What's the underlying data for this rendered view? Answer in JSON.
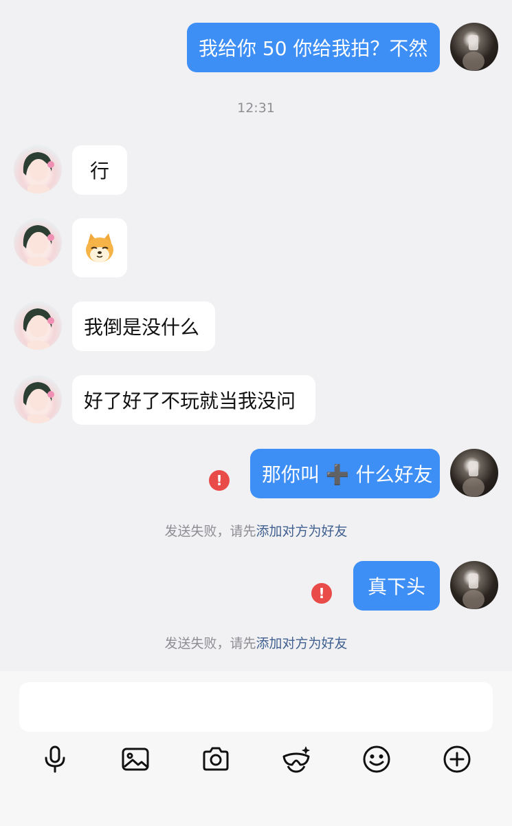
{
  "messages": [
    {
      "side": "out",
      "text": "我给你 50 你给我拍？不然"
    },
    {
      "side": "in",
      "text": "行"
    },
    {
      "side": "in",
      "sticker": "dog-sticker"
    },
    {
      "side": "in",
      "text": "我倒是没什么"
    },
    {
      "side": "in",
      "text": "好了好了不玩就当我没问"
    },
    {
      "side": "out",
      "text": "那你叫 ➕ 什么好友",
      "failed": true
    },
    {
      "side": "out",
      "text": "真下头",
      "failed": true
    }
  ],
  "timestamp": "12:31",
  "fail_notice": {
    "prefix": "发送失败，请先",
    "link": "添加对方为好友"
  },
  "composer": {
    "input_value": "",
    "toolbar_icons": [
      "microphone-icon",
      "image-icon",
      "camera-icon",
      "mask-icon",
      "emoji-icon",
      "plus-icon"
    ]
  },
  "colors": {
    "outgoing_bubble": "#3d8ef5",
    "incoming_bubble": "#ffffff",
    "error": "#e94b49",
    "link": "#3f5f8f",
    "background": "#f1f1f4"
  }
}
